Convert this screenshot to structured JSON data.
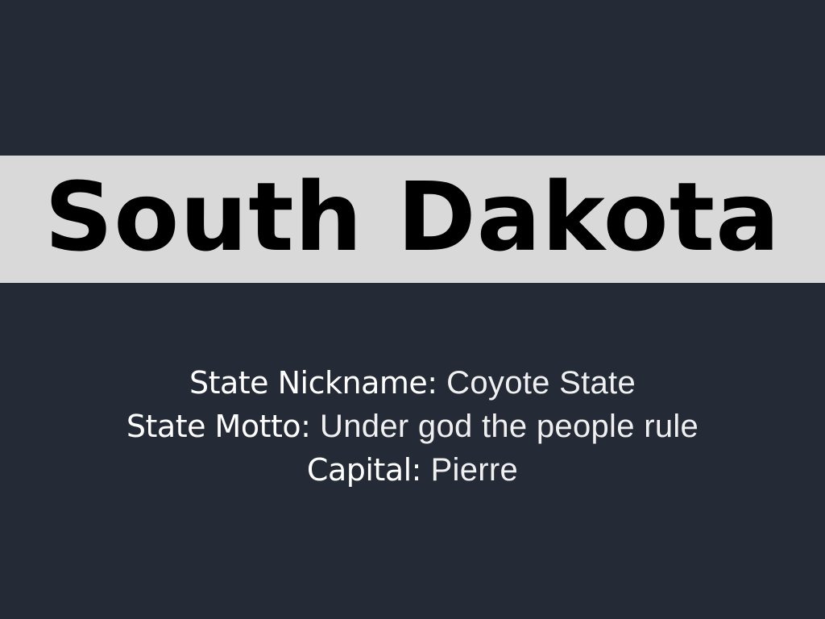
{
  "title": "South Dakota",
  "facts": [
    {
      "label": "State Nickname:",
      "value": "Coyote State"
    },
    {
      "label": "State Motto:",
      "value": "Under god the people rule"
    },
    {
      "label": "Capital:",
      "value": "Pierre"
    }
  ],
  "colors": {
    "background": "#242a36",
    "title_band": "#d9d9d9",
    "title_text": "#000000",
    "body_text": "#ffffff"
  }
}
